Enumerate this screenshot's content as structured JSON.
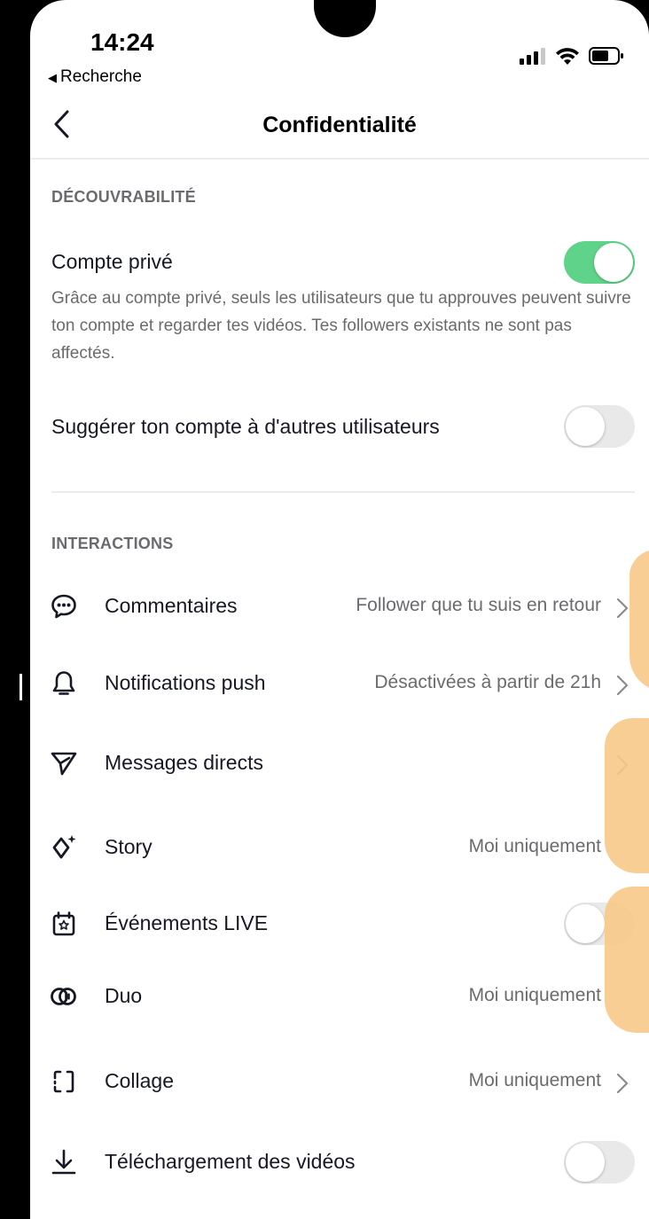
{
  "status_bar": {
    "time": "14:24",
    "back_app": "Recherche",
    "back_app_icon": "triangle-left-icon",
    "icons": [
      "signal-icon",
      "wifi-icon",
      "battery-icon"
    ]
  },
  "nav": {
    "title": "Confidentialité",
    "back_icon": "chevron-left-icon"
  },
  "sections": {
    "discoverability": {
      "header": "DÉCOUVRABILITÉ",
      "private_account": {
        "label": "Compte privé",
        "on": true,
        "description": "Grâce au compte privé, seuls les utilisateurs que tu approuves peuvent suivre ton compte et regarder tes vidéos. Tes followers existants ne sont pas affectés."
      },
      "suggest_account": {
        "label": "Suggérer ton compte à d'autres utilisateurs",
        "on": false
      }
    },
    "interactions": {
      "header": "INTERACTIONS",
      "items": [
        {
          "label": "Commentaires",
          "value": "Follower que tu suis en retour",
          "icon": "comment-icon",
          "chevron": true
        },
        {
          "label": "Notifications push",
          "value": "Désactivées à partir de 21h",
          "icon": "bell-icon",
          "chevron": true
        },
        {
          "label": "Messages directs",
          "value": "",
          "icon": "send-icon",
          "chevron": true
        },
        {
          "label": "Story",
          "value": "Moi uniquement",
          "icon": "story-sparkle-icon",
          "chevron": false
        },
        {
          "label": "Événements LIVE",
          "value": "",
          "icon": "calendar-star-icon",
          "toggle": false
        },
        {
          "label": "Duo",
          "value": "Moi uniquement",
          "icon": "duet-icon",
          "chevron": false
        },
        {
          "label": "Collage",
          "value": "Moi uniquement",
          "icon": "stitch-icon",
          "chevron": true
        },
        {
          "label": "Téléchargement des vidéos",
          "value": "",
          "icon": "download-icon",
          "toggle": false
        }
      ]
    }
  },
  "colors": {
    "toggle_on": "#5fd38a",
    "toggle_off": "#e9e9ea",
    "secondary_text": "#6b6b6f",
    "finger_overlay": "#f7c98a"
  }
}
